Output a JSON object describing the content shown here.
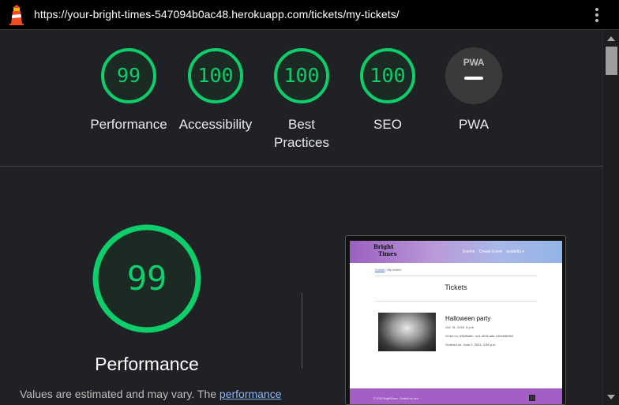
{
  "topbar": {
    "url": "https://your-bright-times-547094b0ac48.herokuapp.com/tickets/my-tickets/",
    "logo_icon": "lighthouse-icon",
    "menu_icon": "kebab-menu-icon"
  },
  "categories": [
    {
      "score": "99",
      "label": "Performance"
    },
    {
      "score": "100",
      "label": "Accessibility"
    },
    {
      "score": "100",
      "label": "Best Practices"
    },
    {
      "score": "100",
      "label": "SEO"
    },
    {
      "score": "",
      "label": "PWA",
      "badge_text": "PWA"
    }
  ],
  "colors": {
    "pass": "#0cce6b",
    "pass_bg": "#1e3a2a",
    "background": "#202124"
  },
  "main": {
    "score": "99",
    "label": "Performance",
    "note_text": "Values are estimated and may vary. The ",
    "note_link": "performance",
    "note_cut": "... ... ..."
  },
  "thumbnail": {
    "brand_line1": "Bright",
    "brand_line2": "Times",
    "nav_events": "Events",
    "nav_create": "Create Event",
    "nav_user": "avabella ▾",
    "breadcrumb_home": "Events",
    "breadcrumb_sep": " / ",
    "breadcrumb_current": "My tickets",
    "title": "Tickets",
    "event_title": "Halloween party",
    "event_date": "Oct. 31, 2024, 8 p.m.",
    "order_no": "Order no. #3b5fa8b...cc4-4578-a8e-12beb0b9b0",
    "ordered_on": "Ordered on: June 2, 2024, 3:55 p.m.",
    "footer_text": "© 2024 BrightTimes. Created by Ava"
  }
}
